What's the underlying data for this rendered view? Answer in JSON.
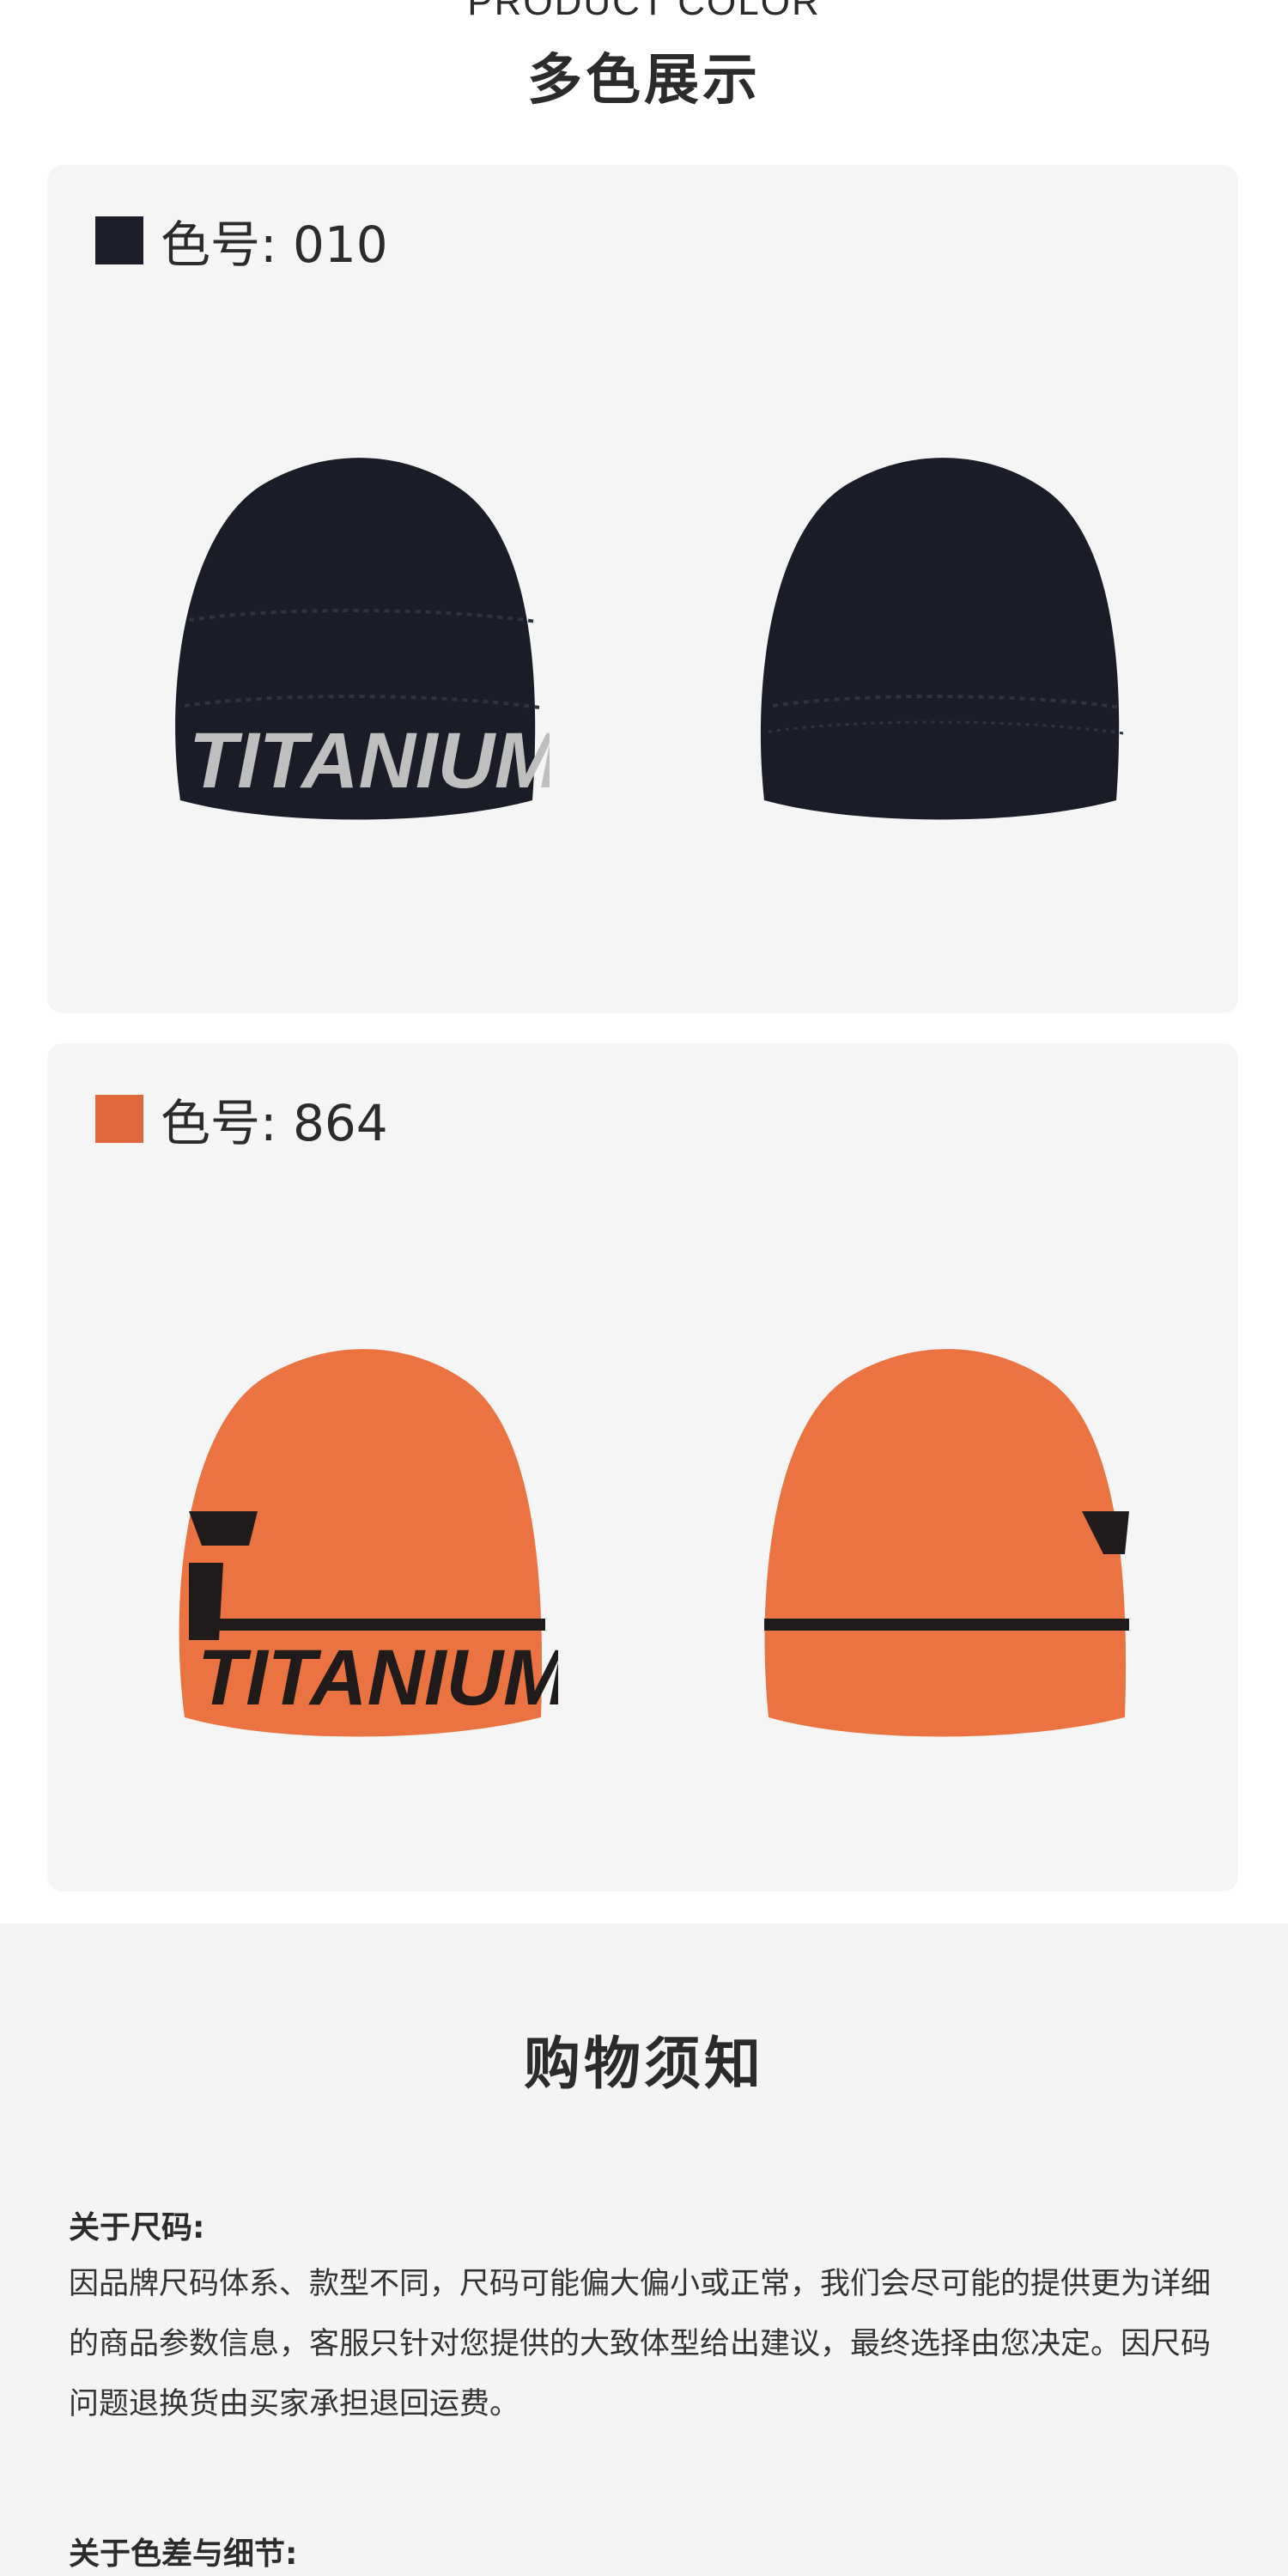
{
  "header": {
    "title_en": "PRODUCT COLOR",
    "title_cn": "多色展示"
  },
  "colors": [
    {
      "label": "色号: 010",
      "swatch": "#1c1f2a",
      "hat_color": "#1a1d28",
      "band_text": "TITANIUM",
      "band_text_color": "#bfbfbf"
    },
    {
      "label": "色号: 864",
      "swatch": "#e0683a",
      "hat_color": "#ea7341",
      "band_text": "TITANIUM",
      "band_text_color": "#1e1b1a"
    }
  ],
  "notice": {
    "title": "购物须知",
    "size_heading": "关于尺码:",
    "size_text": "因品牌尺码体系、款型不同，尺码可能偏大偏小或正常，我们会尽可能的提供更为详细的商品参数信息，客服只针对您提供的大致体型给出建议，最终选择由您决定。因尺码问题退换货由买家承担退回运费。",
    "color_heading": "关于色差与细节:"
  }
}
